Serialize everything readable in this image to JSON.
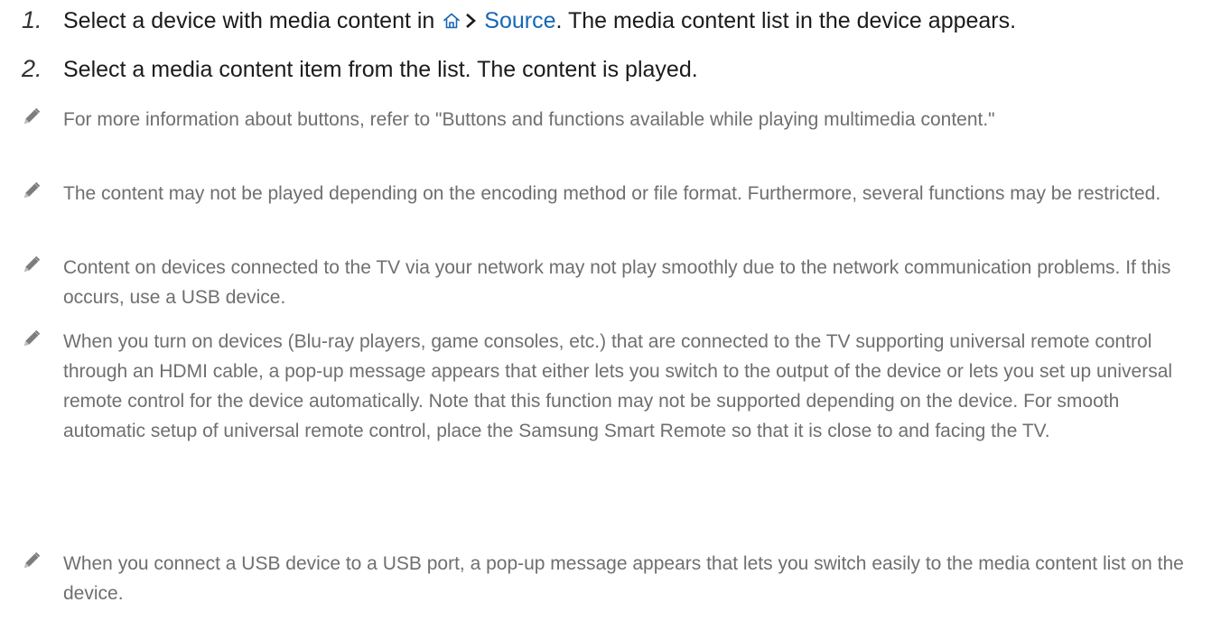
{
  "steps": [
    {
      "number": "1.",
      "text_before": "Select a device with media content in",
      "path_label": "Source",
      "text_after": ". The media content list in the device appears."
    },
    {
      "number": "2.",
      "text": "Select a media content item from the list. The content is played."
    }
  ],
  "notes": [
    "For more information about buttons, refer to \"Buttons and functions available while playing multimedia content.\"",
    "The content may not be played depending on the encoding method or file format. Furthermore, several functions may be restricted.",
    "Content on devices connected to the TV via your network may not play smoothly due to the network communication problems. If this occurs, use a USB device.",
    "When you turn on devices (Blu-ray players, game consoles, etc.) that are connected to the TV supporting universal remote control through an HDMI cable, a pop-up message appears that either lets you switch to the output of the device or lets you set up universal remote control for the device automatically. Note that this function may not be supported depending on the device. For smooth automatic setup of universal remote control, place the Samsung Smart Remote so that it is close to and facing the TV.",
    "When you connect a USB device to a USB port, a pop-up message appears that lets you switch easily to the media content list on the device."
  ],
  "icons": {
    "home": "home-icon",
    "chevron": "chevron-right-icon",
    "note": "pencil-icon"
  },
  "colors": {
    "link": "#1566b8",
    "step_text": "#1b1b1b",
    "note_text": "#6f6f6f"
  }
}
